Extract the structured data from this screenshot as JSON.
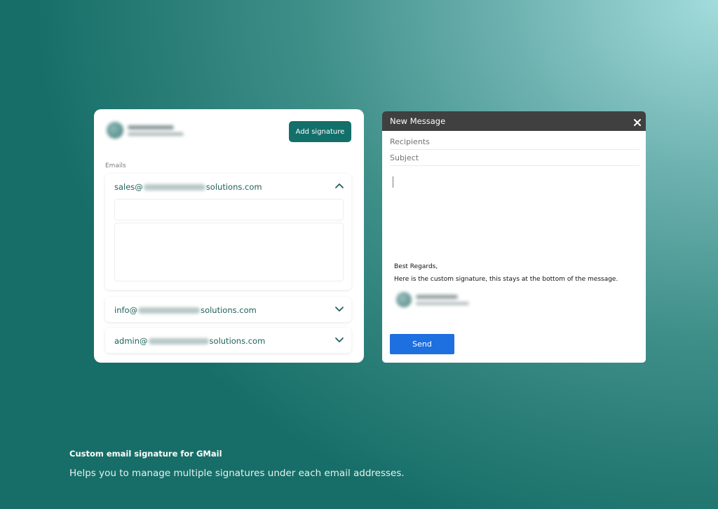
{
  "signature_panel": {
    "add_button_label": "Add signature",
    "emails_label": "Emails",
    "accounts": [
      {
        "prefix": "sales@",
        "suffix": "solutions.com",
        "expanded": true
      },
      {
        "prefix": "info@",
        "suffix": "solutions.com",
        "expanded": false
      },
      {
        "prefix": "admin@",
        "suffix": "solutions.com",
        "expanded": false
      }
    ]
  },
  "compose": {
    "title": "New Message",
    "recipients_placeholder": "Recipients",
    "subject_placeholder": "Subject",
    "signature_line1": "Best Regards,",
    "signature_line2": "Here is the custom signature, this stays at the bottom of the message.",
    "send_label": "Send"
  },
  "caption": {
    "title": "Custom email signature for GMail",
    "description": "Helps you to manage multiple signatures under each email addresses."
  },
  "colors": {
    "accent_teal": "#136f69",
    "send_blue": "#1e6fe0",
    "compose_header": "#404040",
    "email_text": "#1f5f5a"
  },
  "icons": {
    "expanded_chevron": "chevron-up-icon",
    "collapsed_chevron": "chevron-down-icon",
    "close": "close-icon"
  }
}
